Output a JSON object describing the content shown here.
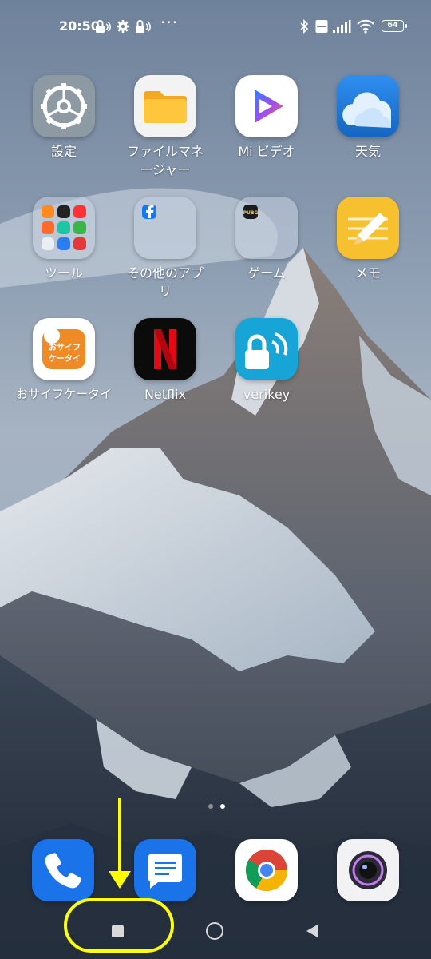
{
  "status_bar": {
    "time": "20:50",
    "battery": "64",
    "more_indicator": "···"
  },
  "apps": [
    {
      "label": "設定",
      "icon": "settings-gear-icon"
    },
    {
      "label": "ファイルマネージャー",
      "icon": "folder-icon"
    },
    {
      "label": "Mi ビデオ",
      "icon": "play-icon"
    },
    {
      "label": "天気",
      "icon": "cloud-icon"
    },
    {
      "label": "ツール",
      "icon": "folder-icon"
    },
    {
      "label": "その他のアプリ",
      "icon": "folder-icon"
    },
    {
      "label": "ゲーム",
      "icon": "folder-icon"
    },
    {
      "label": "メモ",
      "icon": "pencil-icon"
    },
    {
      "label": "おサイフケータイ",
      "icon": "wallet-icon"
    },
    {
      "label": "Netflix",
      "icon": "netflix-n-icon"
    },
    {
      "label": "verikey",
      "icon": "lock-wifi-icon"
    }
  ],
  "folder_mini_labels": {
    "osaifu_icon_text": "おサイフ\nケータイ",
    "netflix_letter": "N",
    "pubg_text": "PUBG"
  },
  "dock": [
    {
      "icon": "phone-icon"
    },
    {
      "icon": "messages-icon"
    },
    {
      "icon": "chrome-icon"
    },
    {
      "icon": "camera-icon"
    }
  ],
  "page_indicator": {
    "count": 2,
    "active": 1
  },
  "nav_bar": [
    "recents-button",
    "home-button",
    "back-button"
  ],
  "colors": {
    "annotation": "#ffff00",
    "netflix_red": "#e50914",
    "weather_blue": "#1e88e5",
    "note_yellow": "#f7c02f",
    "osaifu_orange": "#f08a24",
    "verikey_cyan": "#16a5d6"
  }
}
